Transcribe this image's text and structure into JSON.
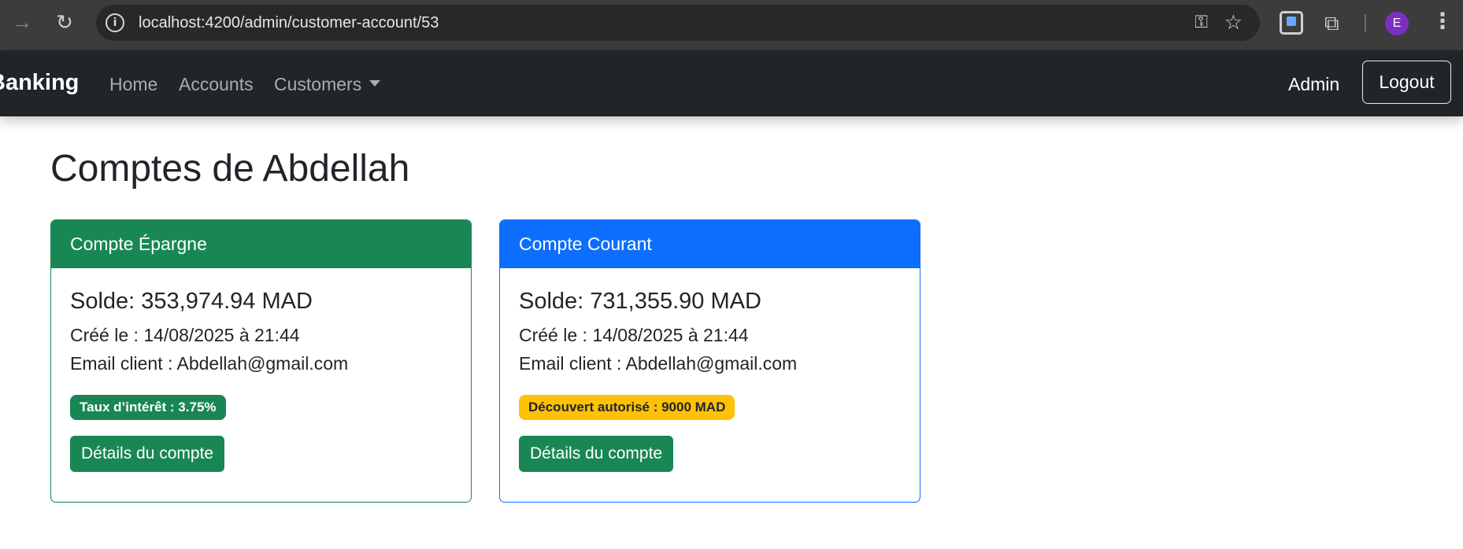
{
  "browser": {
    "url_host": "localhost",
    "url_rest": ":4200/admin/customer-account/53",
    "profile_initial": "E"
  },
  "navbar": {
    "brand": "Banking",
    "links": [
      "Home",
      "Accounts",
      "Customers"
    ],
    "user": "Admin",
    "logout": "Logout"
  },
  "page": {
    "title": "Comptes de Abdellah"
  },
  "accounts": [
    {
      "type": "Compte Épargne",
      "balance": "Solde: 353,974.94 MAD",
      "created": "Créé le : 14/08/2025 à 21:44",
      "email": "Email client : Abdellah@gmail.com",
      "badge": "Taux d’intérêt : 3.75%",
      "button": "Détails du compte",
      "color": "#198754"
    },
    {
      "type": "Compte Courant",
      "balance": "Solde: 731,355.90 MAD",
      "created": "Créé le : 14/08/2025 à 21:44",
      "email": "Email client : Abdellah@gmail.com",
      "badge": "Découvert autorisé : 9000 MAD",
      "button": "Détails du compte",
      "color": "#0d6efd"
    }
  ]
}
